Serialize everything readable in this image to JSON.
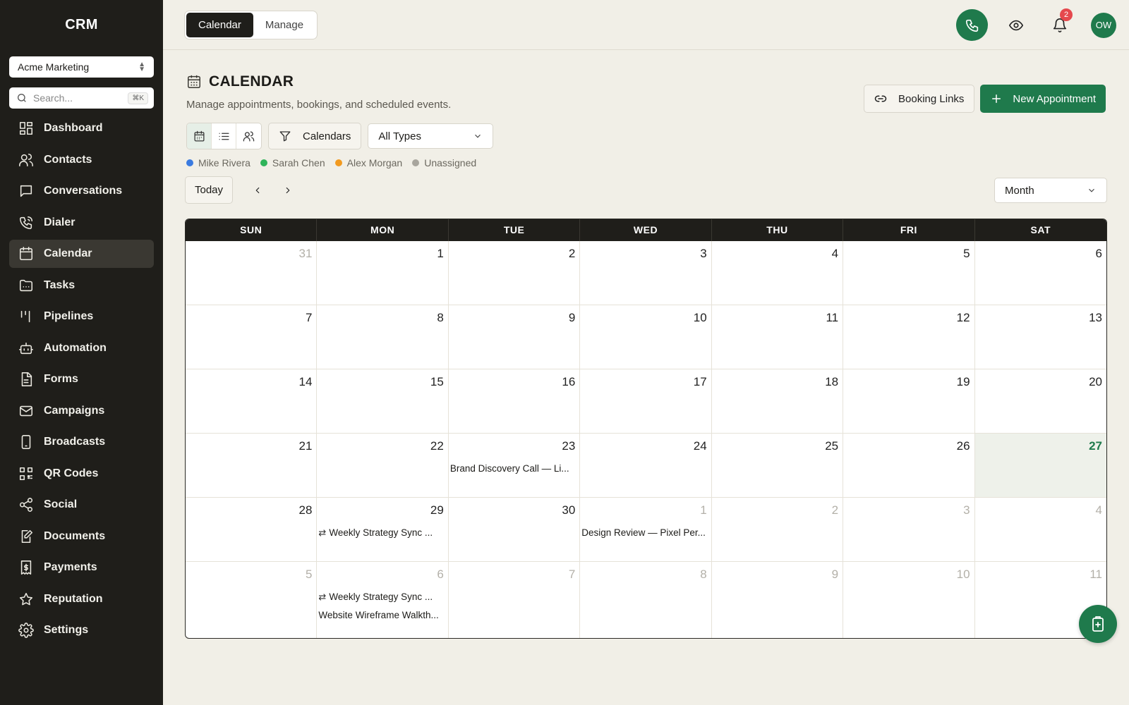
{
  "app": {
    "brand": "CRM"
  },
  "sidebar": {
    "org_select": "Acme Marketing",
    "search_placeholder": "Search...",
    "search_shortcut": "⌘K",
    "items": [
      {
        "label": "Dashboard",
        "icon": "grid-icon"
      },
      {
        "label": "Contacts",
        "icon": "users-icon"
      },
      {
        "label": "Conversations",
        "icon": "chat-icon"
      },
      {
        "label": "Dialer",
        "icon": "phone-icon"
      },
      {
        "label": "Calendar",
        "icon": "calendar-icon",
        "active": true
      },
      {
        "label": "Tasks",
        "icon": "folder-icon"
      },
      {
        "label": "Pipelines",
        "icon": "pipelines-icon"
      },
      {
        "label": "Automation",
        "icon": "bot-icon"
      },
      {
        "label": "Forms",
        "icon": "form-icon"
      },
      {
        "label": "Campaigns",
        "icon": "mail-icon"
      },
      {
        "label": "Broadcasts",
        "icon": "device-icon"
      },
      {
        "label": "QR Codes",
        "icon": "qr-icon"
      },
      {
        "label": "Social",
        "icon": "share-icon"
      },
      {
        "label": "Documents",
        "icon": "document-edit-icon"
      },
      {
        "label": "Payments",
        "icon": "receipt-icon"
      },
      {
        "label": "Reputation",
        "icon": "star-icon"
      },
      {
        "label": "Settings",
        "icon": "gear-icon"
      }
    ]
  },
  "topbar": {
    "tabs": [
      {
        "label": "Calendar",
        "active": true
      },
      {
        "label": "Manage",
        "active": false
      }
    ],
    "notification_count": "2",
    "avatar_initials": "OW"
  },
  "page": {
    "title": "CALENDAR",
    "subtitle": "Manage appointments, bookings, and scheduled events.",
    "booking_links_label": "Booking Links",
    "new_appointment_label": "New Appointment"
  },
  "filters": {
    "calendars_label": "Calendars",
    "type_select": "All Types",
    "legend": [
      {
        "name": "Mike Rivera",
        "color": "#3b7be0"
      },
      {
        "name": "Sarah Chen",
        "color": "#2fb45a"
      },
      {
        "name": "Alex Morgan",
        "color": "#f29a1f"
      },
      {
        "name": "Unassigned",
        "color": "#a8a59d"
      }
    ]
  },
  "nav": {
    "today_label": "Today",
    "view_select": "Month"
  },
  "calendar": {
    "weekdays": [
      "SUN",
      "MON",
      "TUE",
      "WED",
      "THU",
      "FRI",
      "SAT"
    ],
    "weeks": [
      [
        {
          "d": "31",
          "other": true
        },
        {
          "d": "1"
        },
        {
          "d": "2"
        },
        {
          "d": "3"
        },
        {
          "d": "4"
        },
        {
          "d": "5"
        },
        {
          "d": "6"
        }
      ],
      [
        {
          "d": "7"
        },
        {
          "d": "8"
        },
        {
          "d": "9"
        },
        {
          "d": "10"
        },
        {
          "d": "11"
        },
        {
          "d": "12"
        },
        {
          "d": "13"
        }
      ],
      [
        {
          "d": "14"
        },
        {
          "d": "15"
        },
        {
          "d": "16"
        },
        {
          "d": "17"
        },
        {
          "d": "18"
        },
        {
          "d": "19"
        },
        {
          "d": "20"
        }
      ],
      [
        {
          "d": "21"
        },
        {
          "d": "22"
        },
        {
          "d": "23",
          "events": [
            {
              "title": "Brand Discovery Call — Li..."
            }
          ]
        },
        {
          "d": "24"
        },
        {
          "d": "25"
        },
        {
          "d": "26"
        },
        {
          "d": "27",
          "today": true
        }
      ],
      [
        {
          "d": "28"
        },
        {
          "d": "29",
          "events": [
            {
              "title": "Weekly Strategy Sync ...",
              "recurring": true
            }
          ]
        },
        {
          "d": "30"
        },
        {
          "d": "1",
          "other": true,
          "events": [
            {
              "title": "Design Review — Pixel Per..."
            }
          ]
        },
        {
          "d": "2",
          "other": true
        },
        {
          "d": "3",
          "other": true
        },
        {
          "d": "4",
          "other": true
        }
      ],
      [
        {
          "d": "5",
          "other": true
        },
        {
          "d": "6",
          "other": true,
          "events": [
            {
              "title": "Weekly Strategy Sync ...",
              "recurring": true
            },
            {
              "title": "Website Wireframe Walkth..."
            }
          ]
        },
        {
          "d": "7",
          "other": true
        },
        {
          "d": "8",
          "other": true
        },
        {
          "d": "9",
          "other": true
        },
        {
          "d": "10",
          "other": true
        },
        {
          "d": "11",
          "other": true
        }
      ]
    ]
  },
  "colors": {
    "accent": "#1f7a4c",
    "sidebar_bg": "#1f1e1a",
    "page_bg": "#f1efe7"
  }
}
